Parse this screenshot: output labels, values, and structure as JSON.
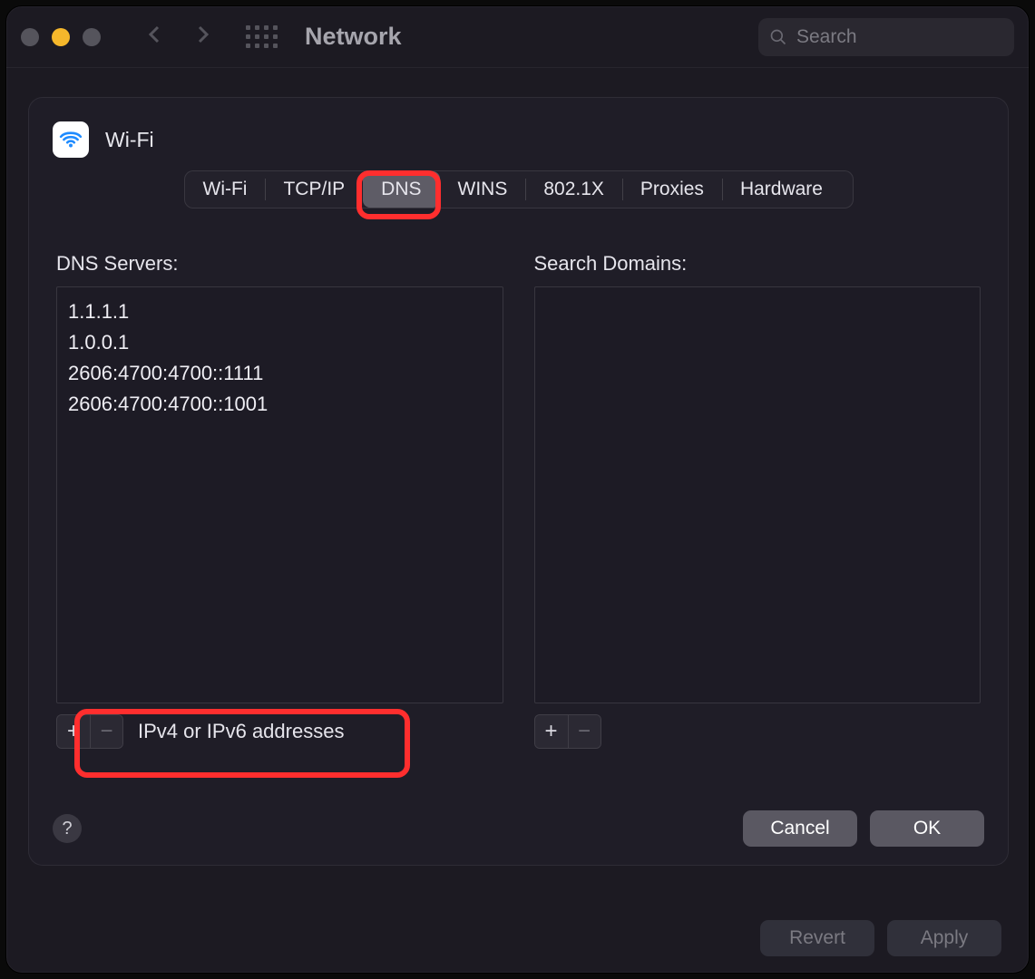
{
  "titlebar": {
    "title": "Network",
    "search_placeholder": "Search"
  },
  "sheet": {
    "interface_name": "Wi-Fi",
    "tabs": [
      "Wi-Fi",
      "TCP/IP",
      "DNS",
      "WINS",
      "802.1X",
      "Proxies",
      "Hardware"
    ],
    "active_tab": "DNS",
    "dns_label": "DNS Servers:",
    "search_domains_label": "Search Domains:",
    "dns_servers": [
      "1.1.1.1",
      "1.0.0.1",
      "2606:4700:4700::1111",
      "2606:4700:4700::1001"
    ],
    "search_domains": [],
    "dns_hint": "IPv4 or IPv6 addresses",
    "icons": {
      "plus": "+",
      "minus": "−",
      "help": "?"
    },
    "buttons": {
      "cancel": "Cancel",
      "ok": "OK"
    }
  },
  "outer_buttons": {
    "revert": "Revert",
    "apply": "Apply"
  }
}
